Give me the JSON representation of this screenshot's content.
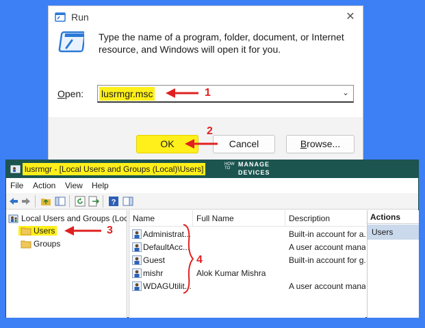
{
  "run": {
    "title": "Run",
    "close": "✕",
    "description": "Type the name of a program, folder, document, or Internet resource, and Windows will open it for you.",
    "open_label_access": "O",
    "open_label_rest": "pen:",
    "open_value": "lusrmgr.msc",
    "ok": "OK",
    "cancel": "Cancel",
    "browse_access": "B",
    "browse_rest": "rowse..."
  },
  "mmc": {
    "title": "lusrmgr - [Local Users and Groups (Local)\\Users]",
    "logo_how": "HOW TO",
    "logo_top": "MANAGE",
    "logo_bottom": "DEVICES",
    "menu": [
      "File",
      "Action",
      "View",
      "Help"
    ],
    "tree": {
      "root": "Local Users and Groups (Local)",
      "items": [
        "Users",
        "Groups"
      ]
    },
    "columns": [
      "Name",
      "Full Name",
      "Description"
    ],
    "rows": [
      {
        "name": "Administrat...",
        "full_name": "",
        "description": "Built-in account for a..."
      },
      {
        "name": "DefaultAcc...",
        "full_name": "",
        "description": "A user account mana..."
      },
      {
        "name": "Guest",
        "full_name": "",
        "description": "Built-in account for g..."
      },
      {
        "name": "mishr",
        "full_name": "Alok Kumar Mishra",
        "description": ""
      },
      {
        "name": "WDAGUtilit...",
        "full_name": "",
        "description": "A user account mana..."
      }
    ],
    "actions_header": "Actions",
    "actions_item": "Users"
  },
  "annotations": [
    "1",
    "2",
    "3",
    "4"
  ],
  "colors": {
    "background": "#3d7ff5",
    "highlight": "#ffef1a",
    "annotation": "#e02020",
    "mmc_titlebar": "#1c5550"
  }
}
